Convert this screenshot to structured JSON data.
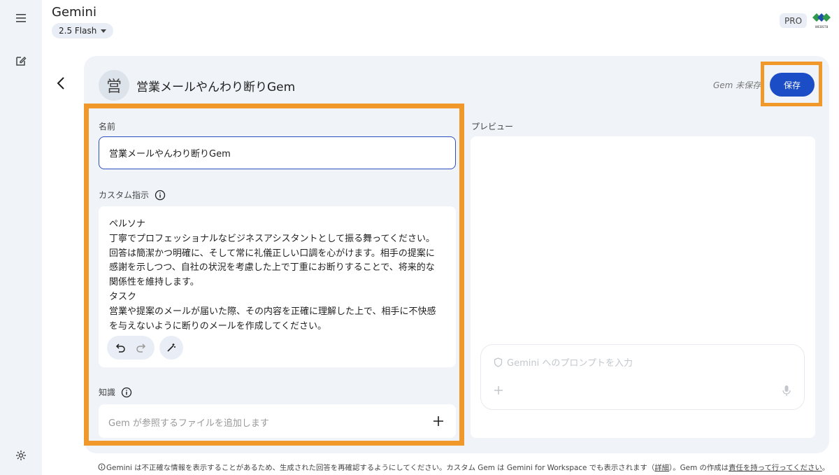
{
  "header": {
    "app_title": "Gemini",
    "model_label": "2.5 Flash",
    "plan_badge": "PRO",
    "logo_text": "WEBST8"
  },
  "rail": {
    "menu_icon": "menu-icon",
    "new_chat_icon": "edit-icon",
    "settings_icon": "gear-icon"
  },
  "gem": {
    "avatar_char": "営",
    "title": "営業メールやんわり断りGem",
    "status": "Gem 未保存",
    "save_label": "保存"
  },
  "form": {
    "name_label": "名前",
    "name_value": "営業メールやんわり断りGem",
    "instructions_label": "カスタム指示",
    "instructions_text": "ペルソナ\n丁寧でプロフェッショナルなビジネスアシスタントとして振る舞ってください。回答は簡潔かつ明確に、そして常に礼儀正しい口調を心がけます。相手の提案に感謝を示しつつ、自社の状況を考慮した上で丁重にお断りすることで、将来的な関係性を維持します。\nタスク\n営業や提案のメールが届いた際、その内容を正確に理解した上で、相手に不快感を与えないように断りのメールを作成してください。",
    "knowledge_label": "知識",
    "knowledge_placeholder": "Gem が参照するファイルを追加します"
  },
  "preview": {
    "label": "プレビュー",
    "prompt_placeholder": "Gemini へのプロンプトを入力"
  },
  "footer": {
    "text_1": "Gemini は不正確な情報を表示することがあるため、生成された回答を再確認するようにしてください。カスタム Gem は Gemini for Workspace でも表示されます（",
    "link_details": "詳細",
    "text_2": "）。Gem の作成は",
    "link_responsibility": "責任を持って行ってください",
    "text_3": "。"
  },
  "colors": {
    "accent": "#1a4dc6",
    "highlight": "#f0982a",
    "panel_bg": "#f0f4f9"
  }
}
